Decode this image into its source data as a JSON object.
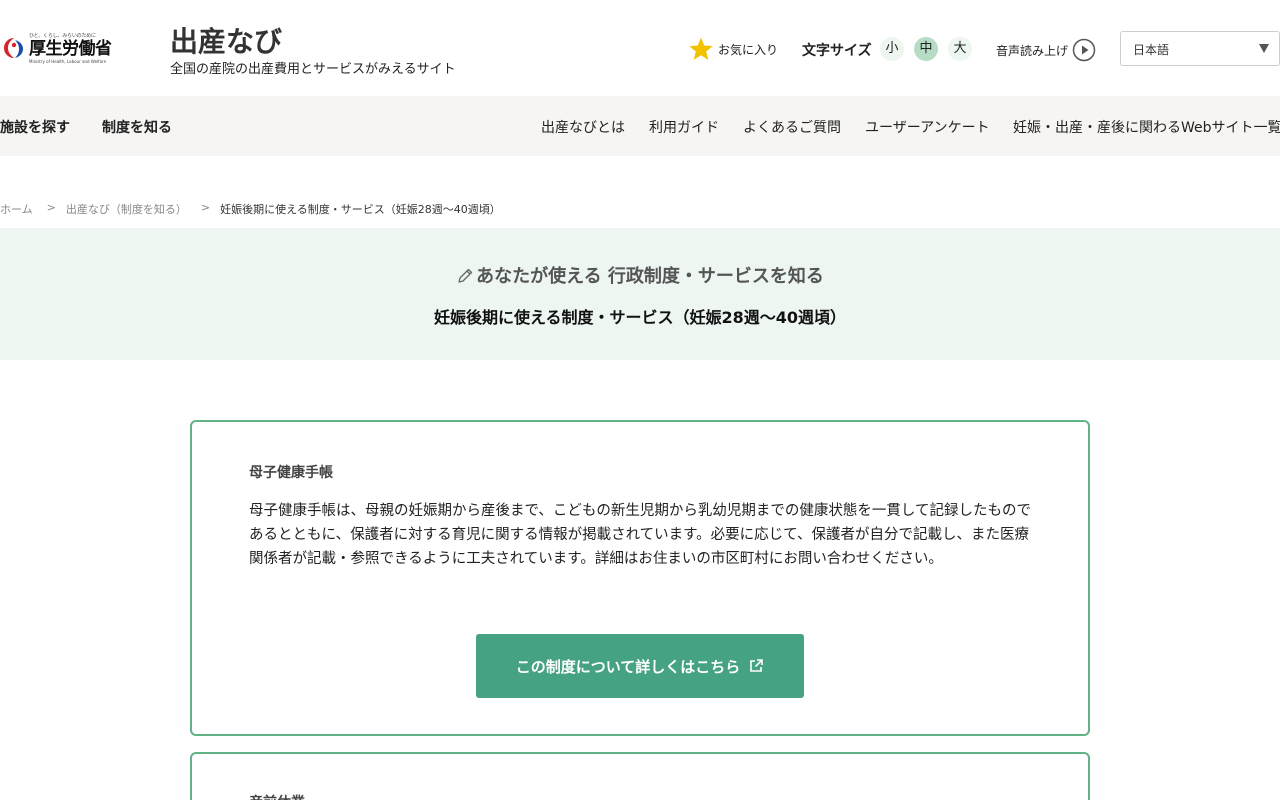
{
  "ministry": {
    "tagline": "ひと、くらし、みらいのために",
    "name": "厚生労働省",
    "english": "Ministry of Health, Labour and Welfare"
  },
  "site": {
    "title": "出産なび",
    "subtitle": "全国の産院の出産費用とサービスがみえるサイト"
  },
  "header": {
    "favorites_label": "お気に入り",
    "fontsize_label": "文字サイズ",
    "fontsize_small": "小",
    "fontsize_medium": "中",
    "fontsize_large": "大",
    "voice_label": "音声読み上げ",
    "language": "日本語"
  },
  "nav": {
    "find_facility": "施設を探す",
    "know_system": "制度を知る",
    "about": "出産なびとは",
    "guide": "利用ガイド",
    "faq": "よくあるご質問",
    "survey": "ユーザーアンケート",
    "links": "妊娠・出産・産後に関わるWebサイト一覧"
  },
  "breadcrumb": {
    "home": "ホーム",
    "section": "出産なび（制度を知る）",
    "current": "妊娠後期に使える制度・サービス（妊娠28週〜40週頃）",
    "separator": ">"
  },
  "hero": {
    "kicker": "あなたが使える 行政制度・サービスを知る",
    "title": "妊娠後期に使える制度・サービス（妊娠28週〜40週頃）"
  },
  "cards": [
    {
      "title": "母子健康手帳",
      "body": "母子健康手帳は、母親の妊娠期から産後まで、こどもの新生児期から乳幼児期までの健康状態を一貫して記録したものであるとともに、保護者に対する育児に関する情報が掲載されています。必要に応じて、保護者が自分で記載し、また医療関係者が記載・参照できるように工夫されています。詳細はお住まいの市区町村にお問い合わせください。",
      "button_label": "この制度について詳しくはこちら"
    },
    {
      "title": "産前休業"
    }
  ],
  "colors": {
    "accent": "#45a282",
    "card_border": "#63b389",
    "hero_bg": "#edf6f1",
    "nav_bg": "#f6f5f3",
    "star": "#f2c200"
  }
}
